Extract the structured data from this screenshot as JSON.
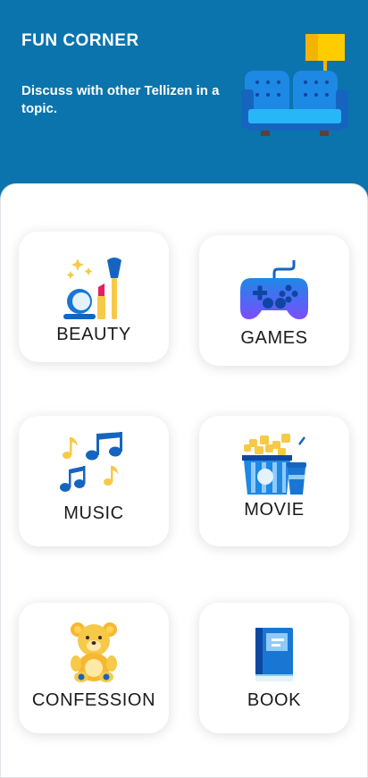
{
  "header": {
    "title": "FUN CORNER",
    "subtitle": "Discuss with other Tellizen in a topic.",
    "illustration_icon": "sofa-lamp-icon"
  },
  "topics": [
    {
      "label": "BEAUTY",
      "icon": "makeup-icon"
    },
    {
      "label": "GAMES",
      "icon": "gamepad-icon"
    },
    {
      "label": "MUSIC",
      "icon": "music-notes-icon"
    },
    {
      "label": "MOVIE",
      "icon": "popcorn-icon"
    },
    {
      "label": "CONFESSION",
      "icon": "teddy-bear-icon"
    },
    {
      "label": "BOOK",
      "icon": "book-icon"
    }
  ],
  "colors": {
    "header_bg": "#0b74ad",
    "card_bg": "#ffffff",
    "label_text": "#1b1b1b",
    "accent_blue": "#1565c0",
    "accent_yellow": "#f7c948"
  }
}
